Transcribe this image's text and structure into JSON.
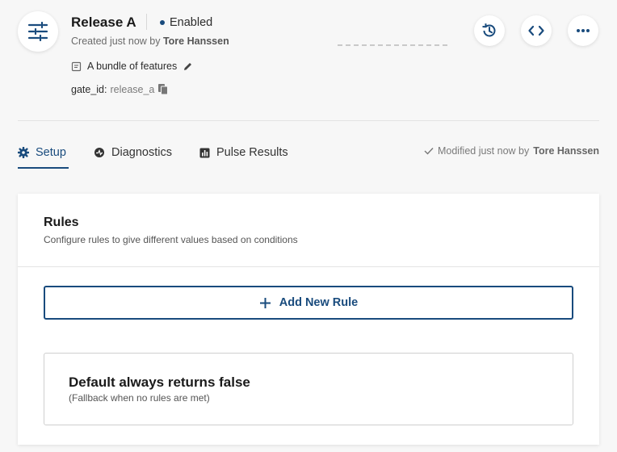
{
  "header": {
    "title": "Release A",
    "status": "Enabled",
    "created_prefix": "Created just now by",
    "created_by": "Tore Hanssen",
    "description": "A bundle of features",
    "gate_id_label": "gate_id:",
    "gate_id_value": "release_a"
  },
  "actions": {
    "history_icon": "history-icon",
    "code_icon": "code-icon",
    "more_icon": "more-icon"
  },
  "tabs": [
    {
      "label": "Setup",
      "icon": "gear-icon",
      "active": true
    },
    {
      "label": "Diagnostics",
      "icon": "diagnostics-icon",
      "active": false
    },
    {
      "label": "Pulse Results",
      "icon": "bar-chart-icon",
      "active": false
    }
  ],
  "modified": {
    "prefix": "Modified just now by",
    "by": "Tore Hanssen"
  },
  "rules": {
    "title": "Rules",
    "subtitle": "Configure rules to give different values based on conditions",
    "add_label": "Add New Rule",
    "default_title": "Default always returns false",
    "default_subtitle": "(Fallback when no rules are met)"
  },
  "colors": {
    "accent": "#194b7d",
    "background": "#f7f7f7"
  }
}
